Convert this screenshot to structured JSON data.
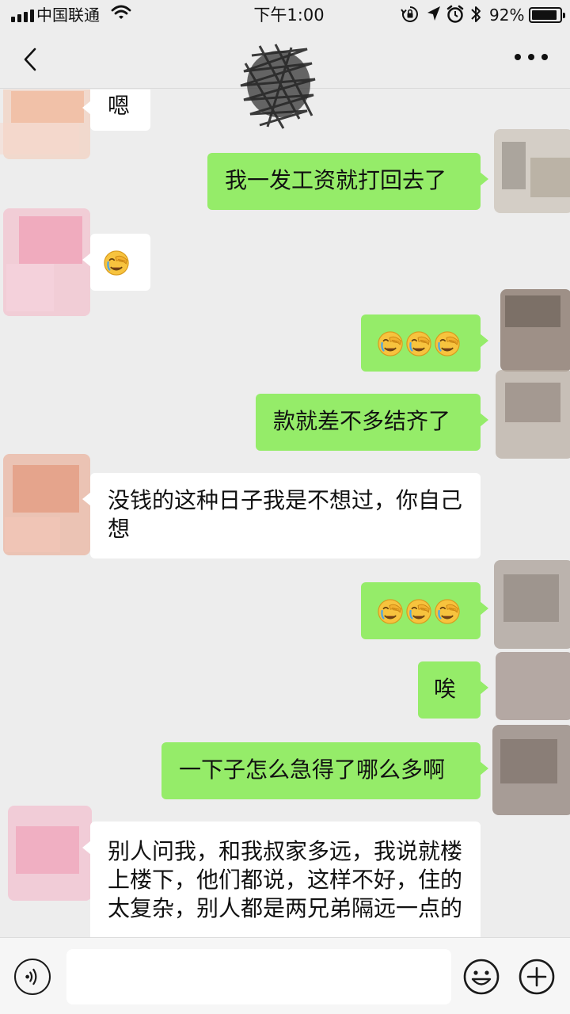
{
  "status_bar": {
    "carrier": "中国联通",
    "time": "下午1:00",
    "battery": "92%",
    "battery_level": 0.92,
    "icons": [
      "signal-icon",
      "wifi-icon",
      "rotation-lock-icon",
      "location-icon",
      "alarm-icon",
      "bluetooth-icon",
      "battery-icon"
    ]
  },
  "nav": {
    "back_icon": "chevron-left-icon",
    "title": "",
    "more_icon": "more-dots-icon"
  },
  "messages": [
    {
      "side": "in",
      "text": "嗯"
    },
    {
      "side": "out",
      "text": "我一发工资就打回去了"
    },
    {
      "side": "in",
      "emoji": "facepalm",
      "count": 1
    },
    {
      "side": "out",
      "emoji": "facepalm",
      "count": 3
    },
    {
      "side": "out",
      "text": "款就差不多结齐了"
    },
    {
      "side": "in",
      "text": "没钱的这种日子我是不想过，你自己想"
    },
    {
      "side": "out",
      "emoji": "facepalm",
      "count": 3
    },
    {
      "side": "out",
      "text": "唉"
    },
    {
      "side": "out",
      "text": "一下子怎么急得了哪么多啊"
    },
    {
      "side": "in",
      "text": "别人问我，和我叔家多远，我说就楼上楼下，他们都说，这样不好，住的太复杂，别人都是两兄弟隔远一点的"
    }
  ],
  "input_bar": {
    "voice_icon": "voice-icon",
    "input_value": "",
    "emoji_icon": "emoji-icon",
    "add_icon": "plus-icon"
  },
  "colors": {
    "background": "#ededed",
    "outgoing_bubble": "#95ec69",
    "incoming_bubble": "#ffffff"
  }
}
